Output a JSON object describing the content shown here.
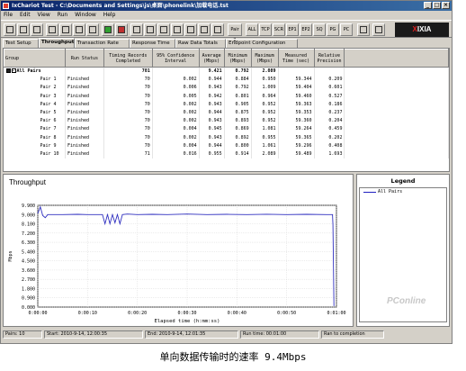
{
  "window": {
    "title": "IxChariot Test - C:\\Documents and Settings\\js\\桌面\\phonelink\\加载电话.tst"
  },
  "menu": [
    "File",
    "Edit",
    "View",
    "Run",
    "Window",
    "Help"
  ],
  "toolbar": {
    "text_buttons": [
      "Pair 2",
      "ALL",
      "TCP",
      "SCR",
      "EP1",
      "EP2",
      "SQ",
      "PG",
      "PC"
    ],
    "brand": "IXIA",
    "brand_x": "X"
  },
  "tabs": [
    "Test Setup",
    "Throughput",
    "Transaction Rate",
    "Response Time",
    "Raw Data Totals",
    "Endpoint Configuration"
  ],
  "table": {
    "headers": [
      "Group",
      "Run Status",
      "Timing Records Completed",
      "95% Confidence Interval",
      "Average (Mbps)",
      "Minimum (Mbps)",
      "Maximum (Mbps)",
      "Measured Time (sec)",
      "Relative Precision"
    ],
    "summary": {
      "group": "All Pairs",
      "records": "701",
      "average": "9.421",
      "minimum": "0.792",
      "maximum": "2.089"
    },
    "rows": [
      [
        "Pair 1",
        "Finished",
        "70",
        "0.002",
        "0.944",
        "0.884",
        "0.950",
        "59.344",
        "0.209"
      ],
      [
        "Pair 2",
        "Finished",
        "70",
        "0.006",
        "0.943",
        "0.792",
        "1.009",
        "59.404",
        "0.601"
      ],
      [
        "Pair 3",
        "Finished",
        "70",
        "0.005",
        "0.942",
        "0.801",
        "0.964",
        "59.460",
        "0.527"
      ],
      [
        "Pair 4",
        "Finished",
        "70",
        "0.002",
        "0.943",
        "0.905",
        "0.952",
        "59.363",
        "0.186"
      ],
      [
        "Pair 5",
        "Finished",
        "70",
        "0.002",
        "0.944",
        "0.875",
        "0.952",
        "59.353",
        "0.237"
      ],
      [
        "Pair 6",
        "Finished",
        "70",
        "0.002",
        "0.943",
        "0.893",
        "0.952",
        "59.360",
        "0.204"
      ],
      [
        "Pair 7",
        "Finished",
        "70",
        "0.004",
        "0.945",
        "0.869",
        "1.081",
        "59.264",
        "0.459"
      ],
      [
        "Pair 8",
        "Finished",
        "70",
        "0.002",
        "0.943",
        "0.892",
        "0.955",
        "59.365",
        "0.202"
      ],
      [
        "Pair 9",
        "Finished",
        "70",
        "0.004",
        "0.944",
        "0.800",
        "1.061",
        "59.296",
        "0.408"
      ],
      [
        "Pair 10",
        "Finished",
        "71",
        "0.016",
        "0.955",
        "0.914",
        "2.089",
        "59.489",
        "1.693"
      ]
    ]
  },
  "chart_data": {
    "type": "line",
    "title": "Throughput",
    "xlabel": "Elapsed time (h:mm:ss)",
    "ylabel": "Mbps",
    "yticks": [
      "0.000",
      "0.900",
      "1.800",
      "2.700",
      "3.600",
      "4.500",
      "5.400",
      "6.300",
      "7.200",
      "8.100",
      "9.000",
      "9.900"
    ],
    "xticks": [
      "0:00:00",
      "0:00:10",
      "0:00:20",
      "0:00:30",
      "0:00:40",
      "0:00:50",
      "0:01:00"
    ],
    "ylim": [
      0,
      9.9
    ],
    "xlim": [
      0,
      60
    ],
    "grid": true,
    "series": [
      {
        "name": "All Pairs",
        "color": "#3030c0",
        "x": [
          0,
          0.5,
          1,
          1.5,
          2,
          3,
          5,
          8,
          10,
          13,
          13.5,
          14,
          14.5,
          15,
          15.5,
          16,
          16.5,
          17,
          18,
          20,
          23,
          26,
          30,
          34,
          38,
          42,
          46,
          50,
          54,
          58,
          59.2,
          59.3,
          59.5
        ],
        "y": [
          9.1,
          9.75,
          8.9,
          8.7,
          9.0,
          9.0,
          9.0,
          9.02,
          9.0,
          9.0,
          8.1,
          9.0,
          8.1,
          9.0,
          8.2,
          9.0,
          8.1,
          9.0,
          9.05,
          9.0,
          9.02,
          9.0,
          9.05,
          9.0,
          9.02,
          9.0,
          9.03,
          9.0,
          9.02,
          9.0,
          9.0,
          8.0,
          0.1
        ]
      }
    ]
  },
  "legend": {
    "title": "Legend",
    "entries": [
      "All Pairs"
    ]
  },
  "watermark": "PConline",
  "status": [
    "Pairs: 10",
    "Start: 2010-9-14, 12:00:35",
    "End: 2010-9-14, 12:01:35",
    "Run time: 00:01:00",
    "Ran to completion"
  ],
  "caption": "单向数据传输时的速率 9.4Mbps"
}
